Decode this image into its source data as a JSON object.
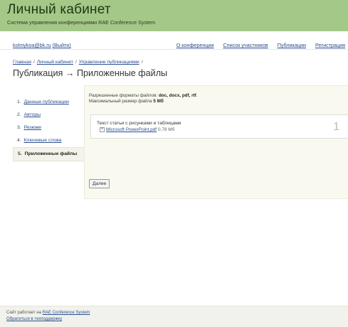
{
  "header": {
    "title": "Личный кабинет",
    "subtitle": "Система управления конференциями RAE Conference System"
  },
  "topnav": {
    "user_email": "kolmykoa@bk.ru",
    "logout_label": "(Выйти)",
    "links": [
      "О конференции",
      "Список участников",
      "Публикации",
      "Регистрация"
    ]
  },
  "breadcrumb": [
    "Главная",
    "Личный кабинет",
    "Управление публикациями"
  ],
  "page_title": "Публикация → Приложенные файлы",
  "steps": [
    {
      "num": "1.",
      "label": "Данные публикации"
    },
    {
      "num": "2.",
      "label": "Авторы"
    },
    {
      "num": "3.",
      "label": "Резюме"
    },
    {
      "num": "4.",
      "label": "Ключевые слова"
    },
    {
      "num": "5.",
      "label": "Приложенные файлы"
    }
  ],
  "formats": {
    "allowed_prefix": "Разрешенные форматы файлов:",
    "allowed_list": "doc, docx, pdf, rtf",
    "max_prefix": "Максимальный размер файла",
    "max_size": "5 Мб"
  },
  "file_box": {
    "label": "Текст статьи с рисунками и таблицами",
    "toggle": "+",
    "file_name": "Microsoft PowerPoint.pdf",
    "file_size": "0.78 Мб",
    "number": "1"
  },
  "next_button": "Далее",
  "footer": {
    "powered_prefix": "Сайт работает на",
    "powered_link": "RAE Conference System",
    "support_link": "Обратиться в техподдержку"
  },
  "colors": {
    "header_bg": "#a4c888",
    "link": "#2a4d8f",
    "panel_bg": "#f9f9ef"
  }
}
